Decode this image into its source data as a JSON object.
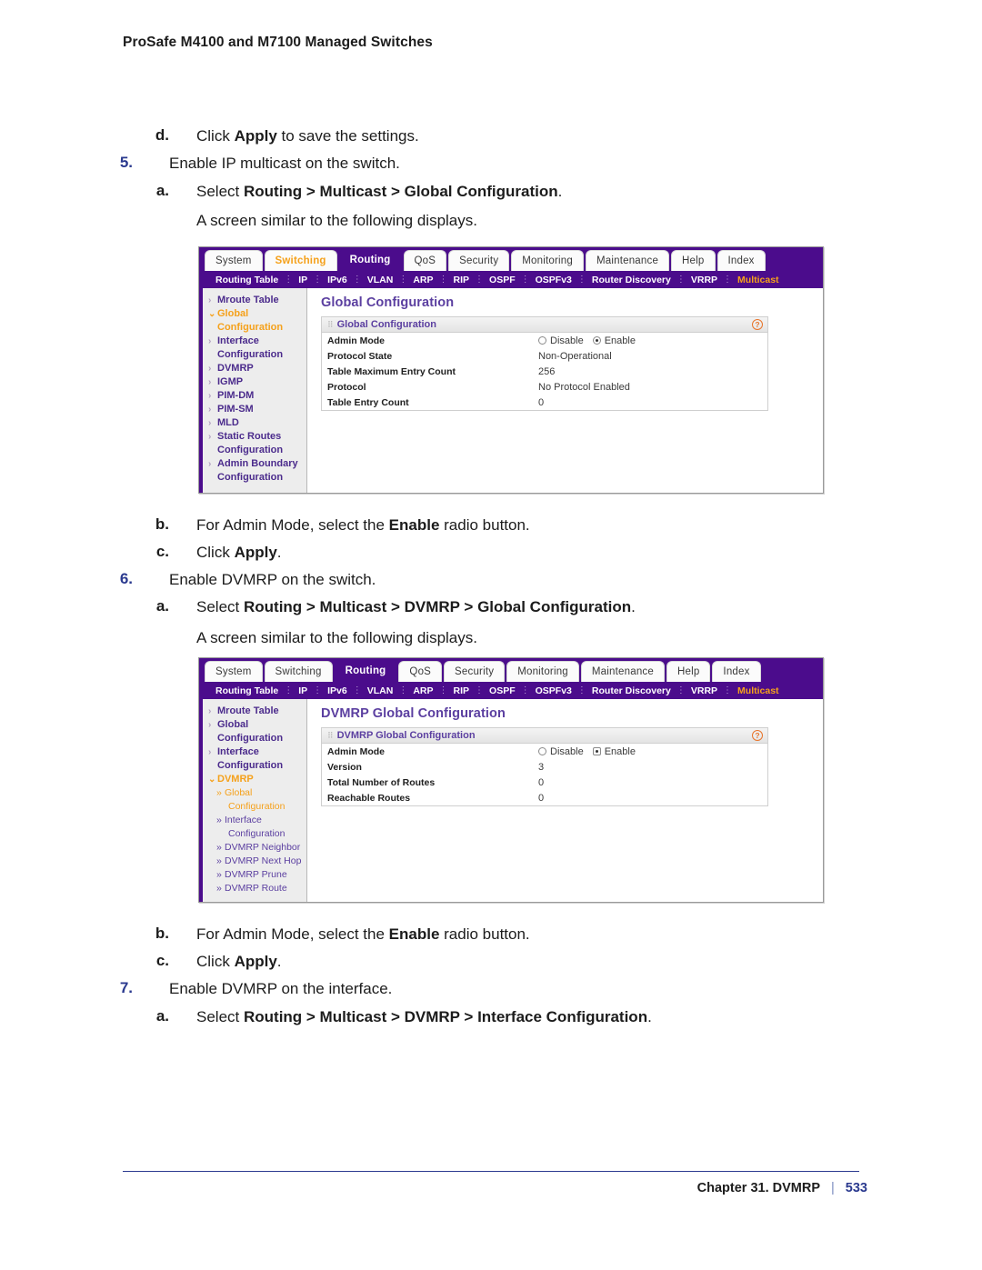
{
  "page_header": "ProSafe M4100 and M7100 Managed Switches",
  "steps": [
    {
      "marker": "d.",
      "marker_type": "alpha",
      "text_runs": [
        {
          "t": "Click ",
          "b": false
        },
        {
          "t": "Apply",
          "b": true
        },
        {
          "t": " to save the settings.",
          "b": false
        }
      ]
    },
    {
      "marker": "5.",
      "marker_type": "num",
      "text_runs": [
        {
          "t": "Enable IP multicast on the switch.",
          "b": false
        }
      ]
    },
    {
      "marker": "a.",
      "marker_type": "alpha",
      "text_runs": [
        {
          "t": "Select ",
          "b": false
        },
        {
          "t": "Routing > Multicast > Global Configuration",
          "b": true
        },
        {
          "t": ".",
          "b": false
        }
      ]
    },
    {
      "marker": "",
      "marker_type": "none",
      "text_runs": [
        {
          "t": "A screen similar to the following displays.",
          "b": false
        }
      ]
    },
    {
      "marker": "b.",
      "marker_type": "alpha",
      "text_runs": [
        {
          "t": "For Admin Mode, select the ",
          "b": false
        },
        {
          "t": "Enable",
          "b": true
        },
        {
          "t": " radio button.",
          "b": false
        }
      ]
    },
    {
      "marker": "c.",
      "marker_type": "alpha",
      "text_runs": [
        {
          "t": "Click ",
          "b": false
        },
        {
          "t": "Apply",
          "b": true
        },
        {
          "t": ".",
          "b": false
        }
      ]
    },
    {
      "marker": "6.",
      "marker_type": "num",
      "text_runs": [
        {
          "t": "Enable DVMRP on the switch.",
          "b": false
        }
      ]
    },
    {
      "marker": "a.",
      "marker_type": "alpha",
      "text_runs": [
        {
          "t": "Select ",
          "b": false
        },
        {
          "t": "Routing > Multicast > DVMRP > Global Configuration",
          "b": true
        },
        {
          "t": ".",
          "b": false
        }
      ]
    },
    {
      "marker": "",
      "marker_type": "none",
      "text_runs": [
        {
          "t": "A screen similar to the following displays.",
          "b": false
        }
      ]
    },
    {
      "marker": "b.",
      "marker_type": "alpha",
      "text_runs": [
        {
          "t": "For Admin Mode, select the ",
          "b": false
        },
        {
          "t": "Enable",
          "b": true
        },
        {
          "t": " radio button.",
          "b": false
        }
      ]
    },
    {
      "marker": "c.",
      "marker_type": "alpha",
      "text_runs": [
        {
          "t": "Click ",
          "b": false
        },
        {
          "t": "Apply",
          "b": true
        },
        {
          "t": ".",
          "b": false
        }
      ]
    },
    {
      "marker": "7.",
      "marker_type": "num",
      "text_runs": [
        {
          "t": "Enable DVMRP on the interface.",
          "b": false
        }
      ]
    },
    {
      "marker": "a.",
      "marker_type": "alpha",
      "text_runs": [
        {
          "t": "Select ",
          "b": false
        },
        {
          "t": "Routing > Multicast > DVMRP > Interface Configuration",
          "b": true
        },
        {
          "t": ".",
          "b": false
        }
      ]
    }
  ],
  "screenshot_1": {
    "tabs": [
      {
        "label": "System",
        "state": "normal"
      },
      {
        "label": "Switching",
        "state": "accent"
      },
      {
        "label": "Routing",
        "state": "active"
      },
      {
        "label": "QoS",
        "state": "normal"
      },
      {
        "label": "Security",
        "state": "normal"
      },
      {
        "label": "Monitoring",
        "state": "normal"
      },
      {
        "label": "Maintenance",
        "state": "normal"
      },
      {
        "label": "Help",
        "state": "normal"
      },
      {
        "label": "Index",
        "state": "normal"
      }
    ],
    "subnav": [
      {
        "label": "Routing Table",
        "state": "normal"
      },
      {
        "label": "IP",
        "state": "normal"
      },
      {
        "label": "IPv6",
        "state": "normal"
      },
      {
        "label": "VLAN",
        "state": "normal"
      },
      {
        "label": "ARP",
        "state": "normal"
      },
      {
        "label": "RIP",
        "state": "normal"
      },
      {
        "label": "OSPF",
        "state": "normal"
      },
      {
        "label": "OSPFv3",
        "state": "normal"
      },
      {
        "label": "Router Discovery",
        "state": "normal"
      },
      {
        "label": "VRRP",
        "state": "normal"
      },
      {
        "label": "Multicast",
        "state": "accent"
      }
    ],
    "sidebar": [
      {
        "label": "Mroute Table",
        "level": 1,
        "state": "normal",
        "arrow": "grey"
      },
      {
        "label": "Global",
        "level": 1,
        "state": "accent",
        "arrow": "orange"
      },
      {
        "label": "Configuration",
        "level": 1,
        "state": "accent",
        "arrow": "none"
      },
      {
        "label": "Interface",
        "level": 1,
        "state": "normal",
        "arrow": "grey"
      },
      {
        "label": "Configuration",
        "level": 1,
        "state": "normal",
        "arrow": "none"
      },
      {
        "label": "DVMRP",
        "level": 1,
        "state": "normal",
        "arrow": "grey"
      },
      {
        "label": "IGMP",
        "level": 1,
        "state": "normal",
        "arrow": "grey"
      },
      {
        "label": "PIM-DM",
        "level": 1,
        "state": "normal",
        "arrow": "grey"
      },
      {
        "label": "PIM-SM",
        "level": 1,
        "state": "normal",
        "arrow": "grey"
      },
      {
        "label": "MLD",
        "level": 1,
        "state": "normal",
        "arrow": "grey"
      },
      {
        "label": "Static Routes",
        "level": 1,
        "state": "normal",
        "arrow": "grey"
      },
      {
        "label": "Configuration",
        "level": 1,
        "state": "normal",
        "arrow": "none"
      },
      {
        "label": "Admin Boundary",
        "level": 1,
        "state": "normal",
        "arrow": "grey"
      },
      {
        "label": "Configuration",
        "level": 1,
        "state": "normal",
        "arrow": "none"
      }
    ],
    "panel_title": "Global Configuration",
    "card_title": "Global Configuration",
    "help_glyph": "?",
    "rows": [
      {
        "label": "Admin Mode",
        "type": "radio",
        "options": [
          "Disable",
          "Enable"
        ],
        "selected": "Enable"
      },
      {
        "label": "Protocol State",
        "type": "text",
        "value": "Non-Operational"
      },
      {
        "label": "Table Maximum Entry Count",
        "type": "text",
        "value": "256"
      },
      {
        "label": "Protocol",
        "type": "text",
        "value": "No Protocol Enabled"
      },
      {
        "label": "Table Entry Count",
        "type": "text",
        "value": "0"
      }
    ]
  },
  "screenshot_2": {
    "tabs": [
      {
        "label": "System",
        "state": "normal"
      },
      {
        "label": "Switching",
        "state": "normal"
      },
      {
        "label": "Routing",
        "state": "active"
      },
      {
        "label": "QoS",
        "state": "normal"
      },
      {
        "label": "Security",
        "state": "normal"
      },
      {
        "label": "Monitoring",
        "state": "normal"
      },
      {
        "label": "Maintenance",
        "state": "normal"
      },
      {
        "label": "Help",
        "state": "normal"
      },
      {
        "label": "Index",
        "state": "normal"
      }
    ],
    "subnav": [
      {
        "label": "Routing Table",
        "state": "normal"
      },
      {
        "label": "IP",
        "state": "normal"
      },
      {
        "label": "IPv6",
        "state": "normal"
      },
      {
        "label": "VLAN",
        "state": "normal"
      },
      {
        "label": "ARP",
        "state": "normal"
      },
      {
        "label": "RIP",
        "state": "normal"
      },
      {
        "label": "OSPF",
        "state": "normal"
      },
      {
        "label": "OSPFv3",
        "state": "normal"
      },
      {
        "label": "Router Discovery",
        "state": "normal"
      },
      {
        "label": "VRRP",
        "state": "normal"
      },
      {
        "label": "Multicast",
        "state": "accent"
      }
    ],
    "sidebar": [
      {
        "label": "Mroute Table",
        "level": 1,
        "state": "normal",
        "arrow": "grey"
      },
      {
        "label": "Global",
        "level": 1,
        "state": "normal",
        "arrow": "grey"
      },
      {
        "label": "Configuration",
        "level": 1,
        "state": "normal",
        "arrow": "none"
      },
      {
        "label": "Interface",
        "level": 1,
        "state": "normal",
        "arrow": "grey"
      },
      {
        "label": "Configuration",
        "level": 1,
        "state": "normal",
        "arrow": "none"
      },
      {
        "label": "DVMRP",
        "level": 1,
        "state": "accent",
        "arrow": "orange"
      },
      {
        "label": "Global",
        "level": 2,
        "state": "accent",
        "arrow": "chev"
      },
      {
        "label": "Configuration",
        "level": 2,
        "state": "accent",
        "arrow": "none"
      },
      {
        "label": "Interface",
        "level": 2,
        "state": "normal",
        "arrow": "chev"
      },
      {
        "label": "Configuration",
        "level": 2,
        "state": "normal",
        "arrow": "none"
      },
      {
        "label": "DVMRP Neighbor",
        "level": 2,
        "state": "normal",
        "arrow": "chev"
      },
      {
        "label": "DVMRP Next Hop",
        "level": 2,
        "state": "normal",
        "arrow": "chev"
      },
      {
        "label": "DVMRP Prune",
        "level": 2,
        "state": "normal",
        "arrow": "chev"
      },
      {
        "label": "DVMRP Route",
        "level": 2,
        "state": "normal",
        "arrow": "chev"
      }
    ],
    "panel_title": "DVMRP Global Configuration",
    "card_title": "DVMRP Global Configuration",
    "help_glyph": "?",
    "rows": [
      {
        "label": "Admin Mode",
        "type": "radio",
        "options": [
          "Disable",
          "Enable"
        ],
        "selected": "Enable"
      },
      {
        "label": "Version",
        "type": "text",
        "value": "3"
      },
      {
        "label": "Total Number of Routes",
        "type": "text",
        "value": "0"
      },
      {
        "label": "Reachable Routes",
        "type": "text",
        "value": "0"
      }
    ]
  },
  "footer": {
    "chapter": "Chapter 31.  DVMRP",
    "separator": "|",
    "page": "533"
  },
  "colors": {
    "brand_purple": "#4b0c8c",
    "accent_orange": "#f5a11b",
    "link_blue": "#2b3a8f",
    "heading_violet": "#5b3fa0",
    "help_orange": "#e8742a"
  }
}
